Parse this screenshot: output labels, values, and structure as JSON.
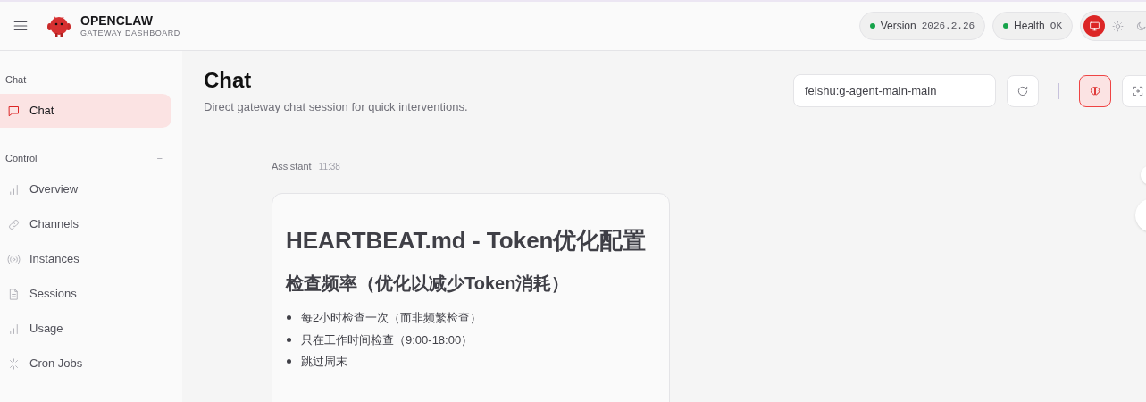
{
  "header": {
    "brand_title": "OPENCLAW",
    "brand_subtitle": "GATEWAY DASHBOARD",
    "status_pills": [
      {
        "label": "Version",
        "value": "2026.2.26"
      },
      {
        "label": "Health",
        "value": "OK"
      }
    ],
    "theme_options": [
      {
        "kind": "system",
        "selected": true
      },
      {
        "kind": "light",
        "selected": false
      },
      {
        "kind": "dark",
        "selected": false
      }
    ]
  },
  "sidebar": {
    "groups": [
      {
        "label": "Chat",
        "collapse_icon": "−",
        "items": [
          {
            "label": "Chat",
            "kind": "chat",
            "selected": true
          }
        ]
      },
      {
        "label": "Control",
        "collapse_icon": "−",
        "items": [
          {
            "label": "Overview",
            "kind": "bars",
            "selected": false
          },
          {
            "label": "Channels",
            "kind": "link",
            "selected": false
          },
          {
            "label": "Instances",
            "kind": "radio",
            "selected": false
          },
          {
            "label": "Sessions",
            "kind": "document",
            "selected": false
          },
          {
            "label": "Usage",
            "kind": "bars",
            "selected": false
          },
          {
            "label": "Cron Jobs",
            "kind": "spinner",
            "selected": false
          }
        ]
      }
    ]
  },
  "page": {
    "title": "Chat",
    "subtitle": "Direct gateway chat session for quick interventions.",
    "session_field": {
      "value": "feishu:g-agent-main-main"
    },
    "toolbar": [
      {
        "kind": "refresh",
        "selected": false
      },
      {
        "kind": "divider"
      },
      {
        "kind": "brain",
        "selected": true
      },
      {
        "kind": "focus",
        "selected": false
      }
    ]
  },
  "messages": [
    {
      "author": "Assistant",
      "time": "11:38",
      "heading_1": "HEARTBEAT.md - Token优化配置",
      "heading_2": "检查频率（优化以减少Token消耗）",
      "bullets": [
        "每2小时检查一次（而非频繁检查）",
        "只在工作时间检查（9:00-18:00）",
        "跳过周末"
      ]
    }
  ]
}
